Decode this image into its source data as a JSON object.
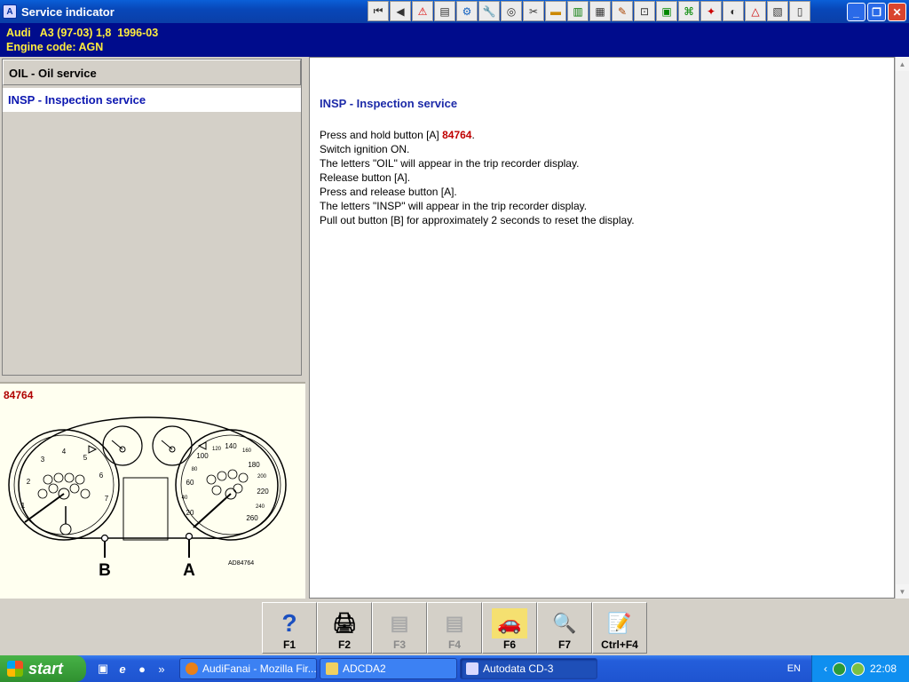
{
  "window": {
    "title": "Service indicator"
  },
  "toolbar": {
    "icons": [
      "first-icon",
      "prev-icon",
      "warning-icon",
      "diagram-icon",
      "engine-icon",
      "wrench-icon",
      "tyre-icon",
      "tools-icon",
      "belt-icon",
      "lift-icon",
      "car-jack-icon",
      "fuel-icon",
      "sensor-icon",
      "book-icon",
      "key-icon",
      "car-repair-icon",
      "gauge-icon",
      "triangle-icon",
      "data-icon",
      "note-icon"
    ]
  },
  "vehicle": {
    "line1": "Audi   A3 (97-03) 1,8  1996-03",
    "line2": "Engine code: AGN"
  },
  "menu": {
    "items": [
      {
        "label": "OIL - Oil service",
        "selected": false
      },
      {
        "label": "INSP - Inspection service",
        "selected": true
      }
    ]
  },
  "figure": {
    "code": "84764",
    "ref": "AD84764",
    "label_a": "A",
    "label_b": "B",
    "speed_ticks": [
      "20",
      "40",
      "60",
      "80",
      "100",
      "120",
      "140",
      "160",
      "180",
      "200",
      "220",
      "240",
      "260"
    ],
    "rev_ticks": [
      "1",
      "2",
      "3",
      "4",
      "5",
      "6",
      "7"
    ]
  },
  "content": {
    "title": "INSP - Inspection service",
    "step1_prefix": "Press and hold button [A] ",
    "step1_ref": "84764",
    "step1_suffix": ".",
    "steps": [
      "Switch ignition ON.",
      "The letters \"OIL\" will appear in the trip recorder display.",
      "Release button [A].",
      "Press and release button [A].",
      "The letters \"INSP\" will appear in the trip recorder display.",
      "Pull out button [B] for approximately 2 seconds to reset the display."
    ]
  },
  "fkeys": [
    {
      "key": "F1",
      "icon": "help-icon",
      "enabled": true
    },
    {
      "key": "F2",
      "icon": "print-icon",
      "enabled": true
    },
    {
      "key": "F3",
      "icon": "image-prev-icon",
      "enabled": false
    },
    {
      "key": "F4",
      "icon": "image-next-icon",
      "enabled": false
    },
    {
      "key": "F6",
      "icon": "car-data-icon",
      "enabled": true
    },
    {
      "key": "F7",
      "icon": "magnifier-icon",
      "enabled": true
    },
    {
      "key": "Ctrl+F4",
      "icon": "notepad-icon",
      "enabled": true
    }
  ],
  "taskbar": {
    "start": "start",
    "tasks": [
      {
        "label": "AudiFanai - Mozilla Fir...",
        "active": false
      },
      {
        "label": "ADCDA2",
        "active": false
      },
      {
        "label": "Autodata CD-3",
        "active": true
      }
    ],
    "lang": "EN",
    "time": "22:08"
  }
}
